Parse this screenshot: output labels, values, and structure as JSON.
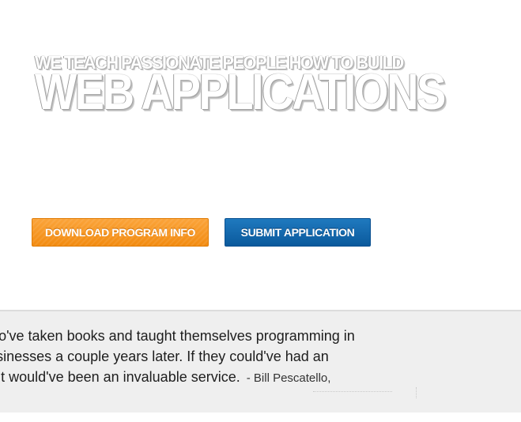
{
  "hero": {
    "kicker": "WE TEACH PASSIONATE PEOPLE HOW TO BUILD",
    "title": "WEB APPLICATIONS"
  },
  "buttons": {
    "download_label": "DOWNLOAD PROGRAM INFO",
    "submit_label": "SUBMIT APPLICATION"
  },
  "testimonial": {
    "lines": [
      "entrepreneurs who've taken books and taught themselves programming in",
      "and have built businesses a couple years later. If they could've had an",
      "to speed that up, it would've been an invaluable service."
    ],
    "author": "- Bill Pescatello,"
  },
  "colors": {
    "orange": "#f5951e",
    "blue": "#0f65aa",
    "band": "#efefef"
  }
}
